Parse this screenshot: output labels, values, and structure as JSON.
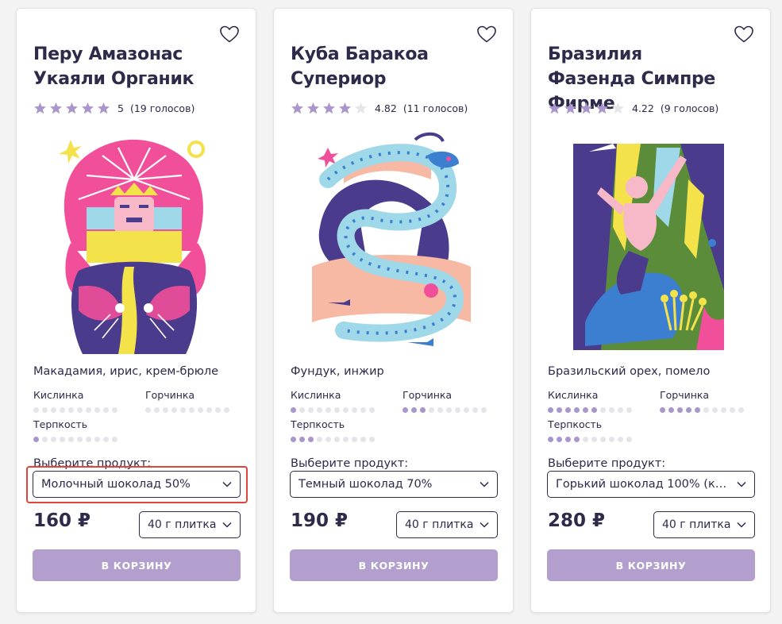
{
  "colors": {
    "accent": "#b39fce",
    "dot_on": "#a996cd",
    "dot_off": "#e4e4ea",
    "star_on": "#a996cd",
    "star_off": "#e6e6ea",
    "text": "#2d2a4a",
    "highlight": "#e0453c"
  },
  "labels": {
    "acidity": "Кислинка",
    "bitterness": "Горчинка",
    "astringency": "Терпкость",
    "choose_product": "Выберите продукт:",
    "add_to_cart": "В КОРЗИНУ"
  },
  "products": [
    {
      "title": "Перу Амазонас Укаяли Органик",
      "rating": 5,
      "rating_label": "5",
      "votes": "(19 голосов)",
      "flavor": "Макадамия, ирис, крем-брюле",
      "acidity": 0,
      "bitterness": 0,
      "astringency": 1,
      "product": "Молочный шоколад 50%",
      "price": "160 ₽",
      "weight": "40 г плитка",
      "art_icon": "sun-spirit-illustration"
    },
    {
      "title": "Куба Баракоа Супериор",
      "rating": 4.82,
      "rating_label": "4.82",
      "votes": "(11 голосов)",
      "flavor": "Фундук, инжир",
      "acidity": 1,
      "bitterness": 3,
      "astringency": 3,
      "product": "Темный шоколад 70%",
      "price": "190 ₽",
      "weight": "40 г плитка",
      "art_icon": "sea-serpent-illustration"
    },
    {
      "title": "Бразилия Фазенда Симпре Фирме",
      "rating": 4.22,
      "rating_label": "4.22",
      "votes": "(9 голосов)",
      "flavor": "Бразильский орех, помело",
      "acidity": 6,
      "bitterness": 5,
      "astringency": 4,
      "product": "Горький шоколад 100% (как…",
      "price": "280 ₽",
      "weight": "40 г плитка",
      "art_icon": "jungle-figure-illustration"
    }
  ]
}
